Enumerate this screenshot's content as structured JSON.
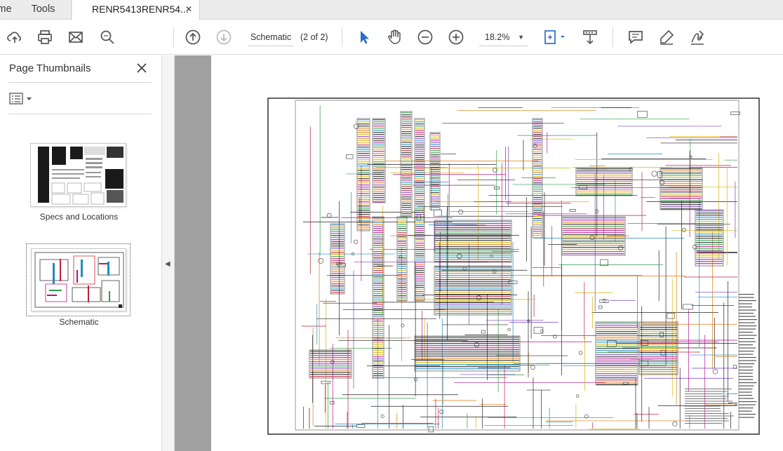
{
  "tabs": {
    "home_label": "Home",
    "tools_label": "Tools",
    "document_label": "RENR5413RENR54...",
    "close_glyph": "✕"
  },
  "toolbar": {
    "page_name": "Schematic",
    "page_count": "(2 of 2)",
    "zoom": "18.2%",
    "icons": [
      "upload-icon",
      "print-icon",
      "mail-icon",
      "search-icon",
      "page-up-icon",
      "page-down-icon",
      "select-arrow-icon",
      "hand-icon",
      "zoom-out-icon",
      "zoom-in-icon",
      "fit-page-icon",
      "scroll-mode-icon",
      "comment-icon",
      "highlight-icon",
      "sign-icon"
    ],
    "accent": "#2a6cc7"
  },
  "left_panel": {
    "title": "Page Thumbnails",
    "thumbnails": [
      {
        "label": "Specs and Locations"
      },
      {
        "label": "Schematic"
      }
    ]
  }
}
